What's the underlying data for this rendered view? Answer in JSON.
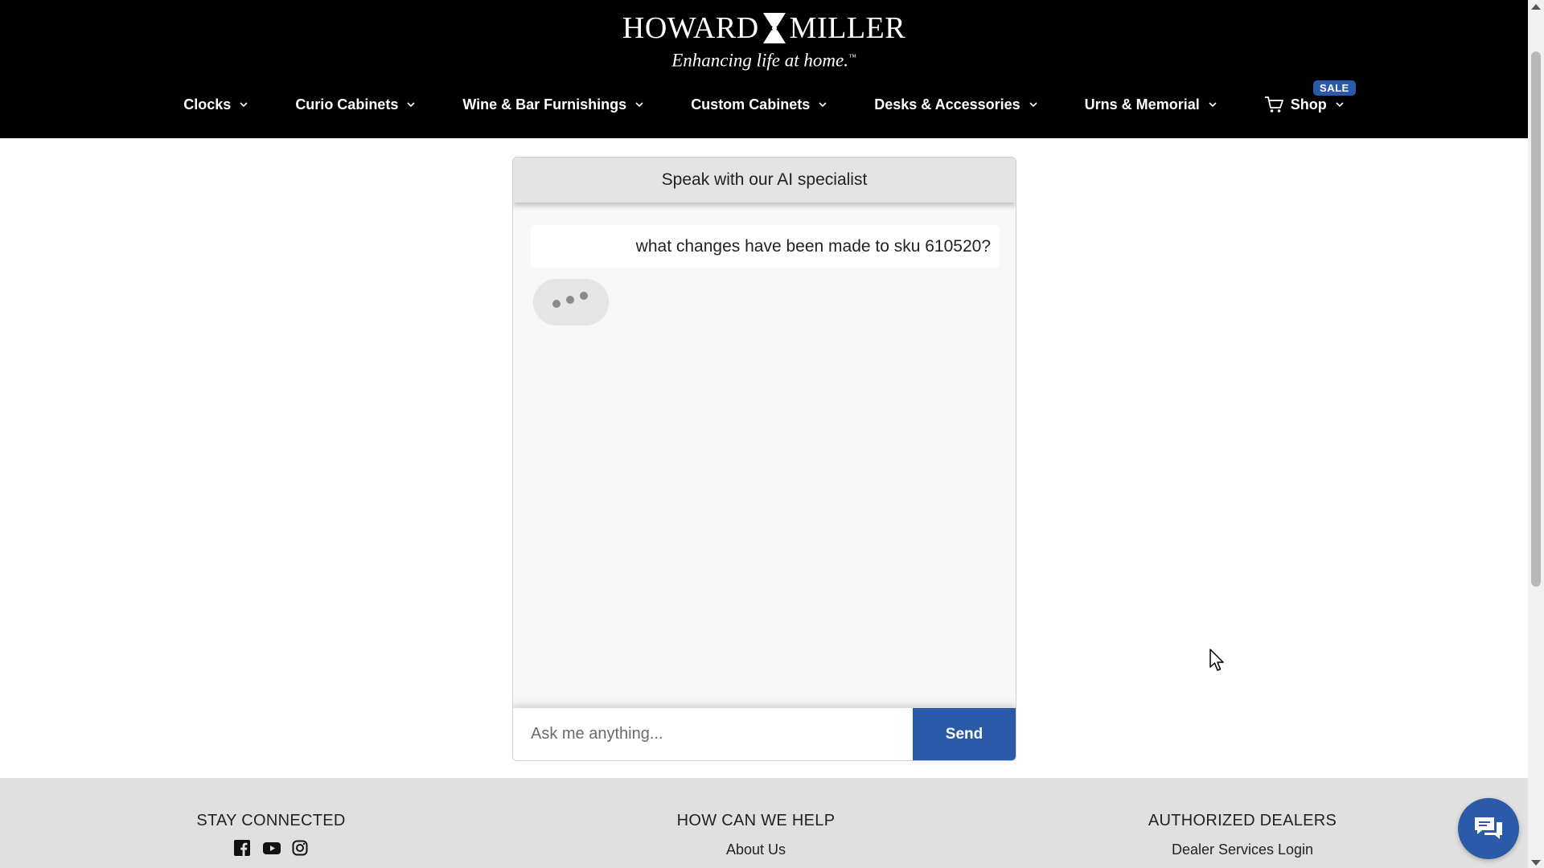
{
  "brand": {
    "name_left": "HOWARD",
    "name_right": "MILLER",
    "tagline": "Enhancing life at home.",
    "tagline_mark": "™"
  },
  "nav": {
    "items": [
      {
        "label": "Clocks"
      },
      {
        "label": "Curio Cabinets"
      },
      {
        "label": "Wine & Bar Furnishings"
      },
      {
        "label": "Custom Cabinets"
      },
      {
        "label": "Desks & Accessories"
      },
      {
        "label": "Urns & Memorial"
      },
      {
        "label": "Shop",
        "icon": "cart-icon",
        "badge": "SALE"
      }
    ]
  },
  "chat": {
    "title": "Speak with our AI specialist",
    "messages": [
      {
        "role": "user",
        "text": "what changes have been made to sku 610520?"
      }
    ],
    "typing_indicator": true,
    "input_placeholder": "Ask me anything...",
    "input_value": "",
    "send_label": "Send"
  },
  "footer": {
    "stay_connected": {
      "heading": "STAY CONNECTED",
      "icons": [
        "facebook-icon",
        "youtube-icon",
        "instagram-icon"
      ]
    },
    "help": {
      "heading": "HOW CAN WE HELP",
      "link": "About Us"
    },
    "dealers": {
      "heading": "AUTHORIZED DEALERS",
      "link": "Dealer Services Login"
    }
  },
  "colors": {
    "header_bg": "#000000",
    "accent": "#2b5aa8",
    "footer_bg": "#e0e0e0"
  }
}
